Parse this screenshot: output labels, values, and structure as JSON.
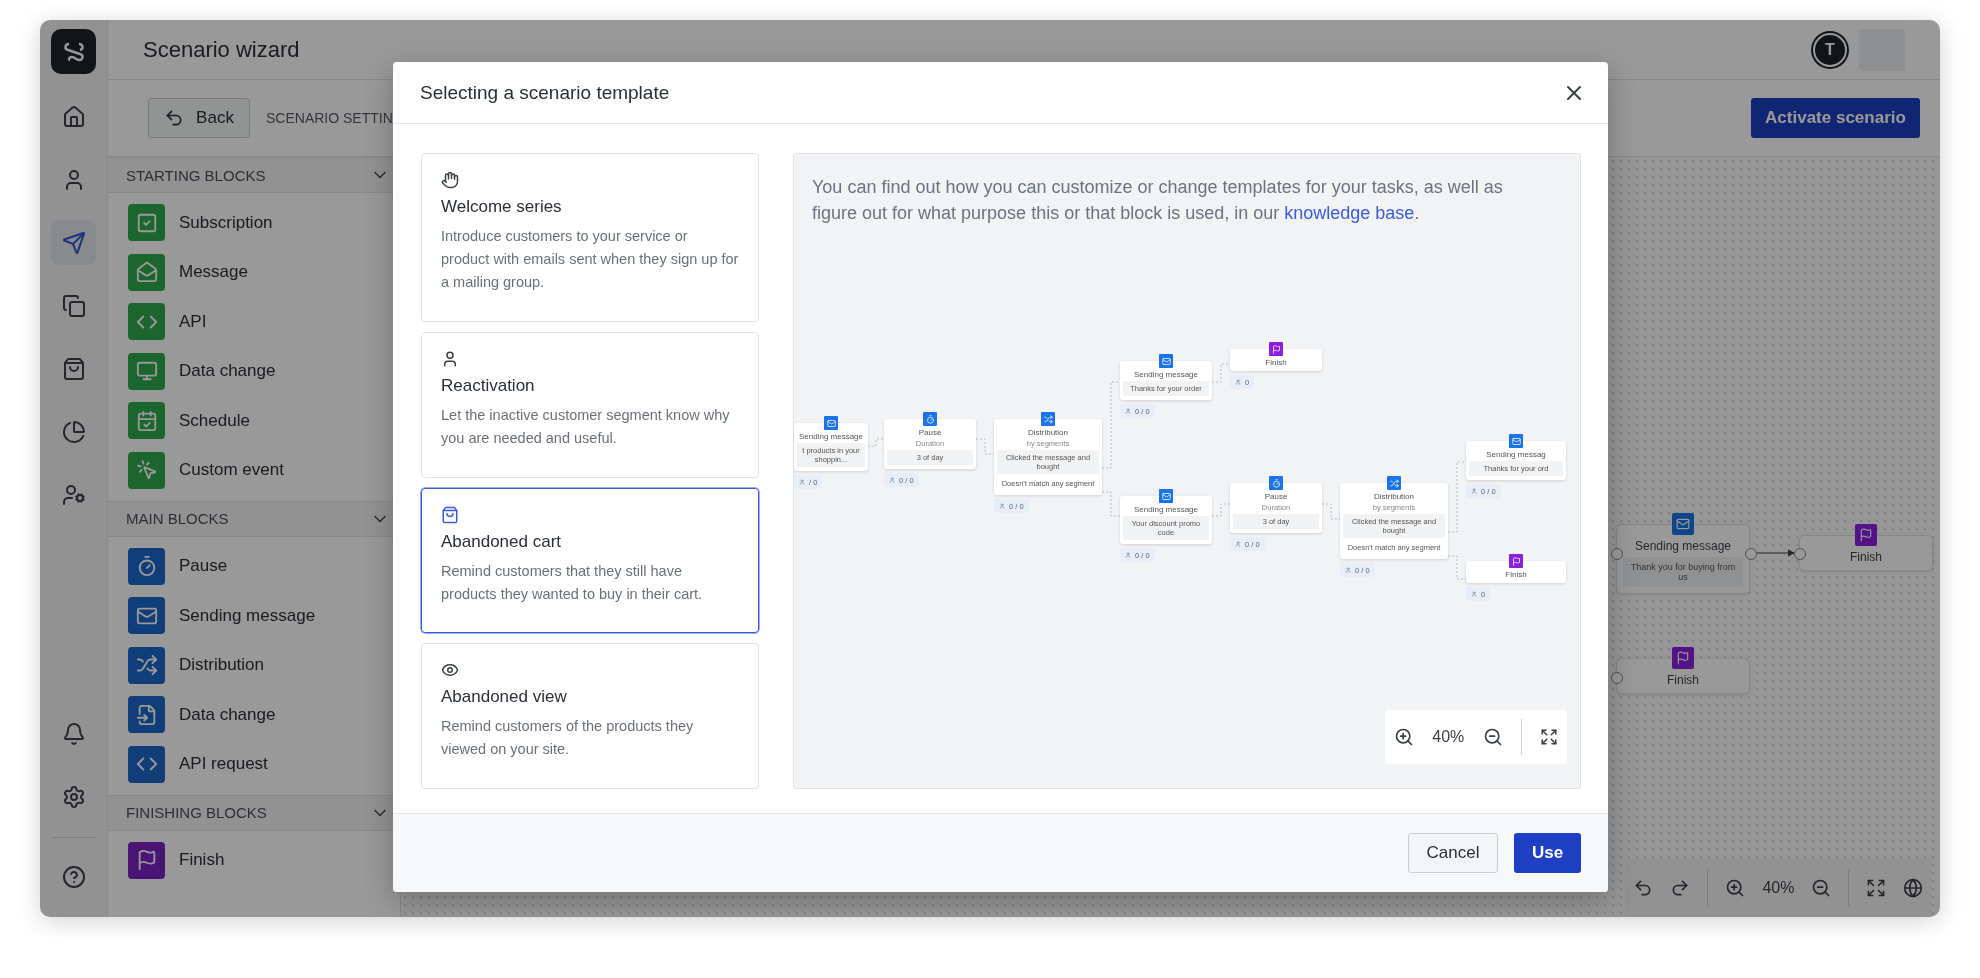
{
  "app": {
    "title": "Scenario wizard",
    "avatar": "T"
  },
  "rail": {
    "top": [
      {
        "selected": false
      },
      {
        "selected": false
      },
      {
        "selected": true
      },
      {
        "selected": false
      },
      {
        "selected": false
      },
      {
        "selected": false
      },
      {
        "selected": false
      }
    ],
    "bottom": [
      {
        "selected": false
      },
      {
        "selected": false
      },
      {
        "selected": false
      }
    ]
  },
  "toolbar": {
    "back": "Back",
    "settings_tab": "SCENARIO SETTIN",
    "activate": "Activate scenario"
  },
  "block_sections": [
    {
      "title": "STARTING BLOCKS",
      "kind": "start",
      "expanded": true,
      "items": [
        "Subscription",
        "Message",
        "API",
        "Data change",
        "Schedule",
        "Custom event"
      ]
    },
    {
      "title": "MAIN BLOCKS",
      "kind": "main",
      "expanded": true,
      "items": [
        "Pause",
        "Sending message",
        "Distribution",
        "Data change",
        "API request"
      ]
    },
    {
      "title": "FINISHING BLOCKS",
      "kind": "finish",
      "expanded": true,
      "items": [
        "Finish"
      ]
    }
  ],
  "canvas": {
    "nodes": [
      {
        "kind": "message",
        "title": "Sending message",
        "text": "Thank you for buying from us"
      },
      {
        "kind": "finish",
        "title": "Finish"
      },
      {
        "kind": "finish",
        "title": "Finish"
      }
    ],
    "zoom": "40%"
  },
  "modal": {
    "title": "Selecting a scenario template",
    "templates": [
      {
        "title": "Welcome series",
        "description": "Introduce customers to your service or product with emails sent when they sign up for a mailing group.",
        "selected": false
      },
      {
        "title": "Reactivation",
        "description": "Let the inactive customer segment know why you are needed and useful.",
        "selected": false
      },
      {
        "title": "Abandoned cart",
        "description": "Remind customers that they still have products they wanted to buy in their cart.",
        "selected": true
      },
      {
        "title": "Abandoned view",
        "description": "Remind customers of the products they viewed on your site.",
        "selected": false
      }
    ],
    "info": {
      "text": "You can find out how you can customize or change templates for your tasks, as well as figure out for what purpose this or that block is used, in our ",
      "link": "knowledge base",
      "end": "."
    },
    "preview_nodes": [
      {
        "kind": "message",
        "title": "Sending message",
        "lines": [
          "t products in your shoppin..."
        ],
        "counter": "/ 0"
      },
      {
        "kind": "pause",
        "title": "Pause",
        "subtitle": "Duration",
        "lines": [
          "3 of day"
        ],
        "counter": "0 / 0"
      },
      {
        "kind": "distribution",
        "title": "Distribution",
        "subtitle": "by segments",
        "lines": [
          "Clicked the message and bought",
          "Doesn't match any segment"
        ],
        "counter": "0 / 0"
      },
      {
        "kind": "message",
        "title": "Sending message",
        "lines": [
          "Thanks for your order"
        ],
        "counter": "0 / 0"
      },
      {
        "kind": "finish",
        "title": "Finish",
        "counter": "0"
      },
      {
        "kind": "message",
        "title": "Sending message",
        "lines": [
          "Your discount promo code"
        ],
        "counter": "0 / 0"
      },
      {
        "kind": "pause",
        "title": "Pause",
        "subtitle": "Duration",
        "lines": [
          "3 of day"
        ],
        "counter": "0 / 0"
      },
      {
        "kind": "distribution",
        "title": "Distribution",
        "subtitle": "by segments",
        "lines": [
          "Clicked the message and bought",
          "Doesn't match any segment"
        ],
        "counter": "0 / 0"
      },
      {
        "kind": "message",
        "title": "Sending messag",
        "lines": [
          "Thanks for your ord"
        ],
        "counter": "0 / 0"
      },
      {
        "kind": "finish",
        "title": "Finish",
        "counter": "0"
      }
    ],
    "preview_zoom": "40%",
    "buttons": {
      "cancel": "Cancel",
      "use": "Use"
    }
  }
}
